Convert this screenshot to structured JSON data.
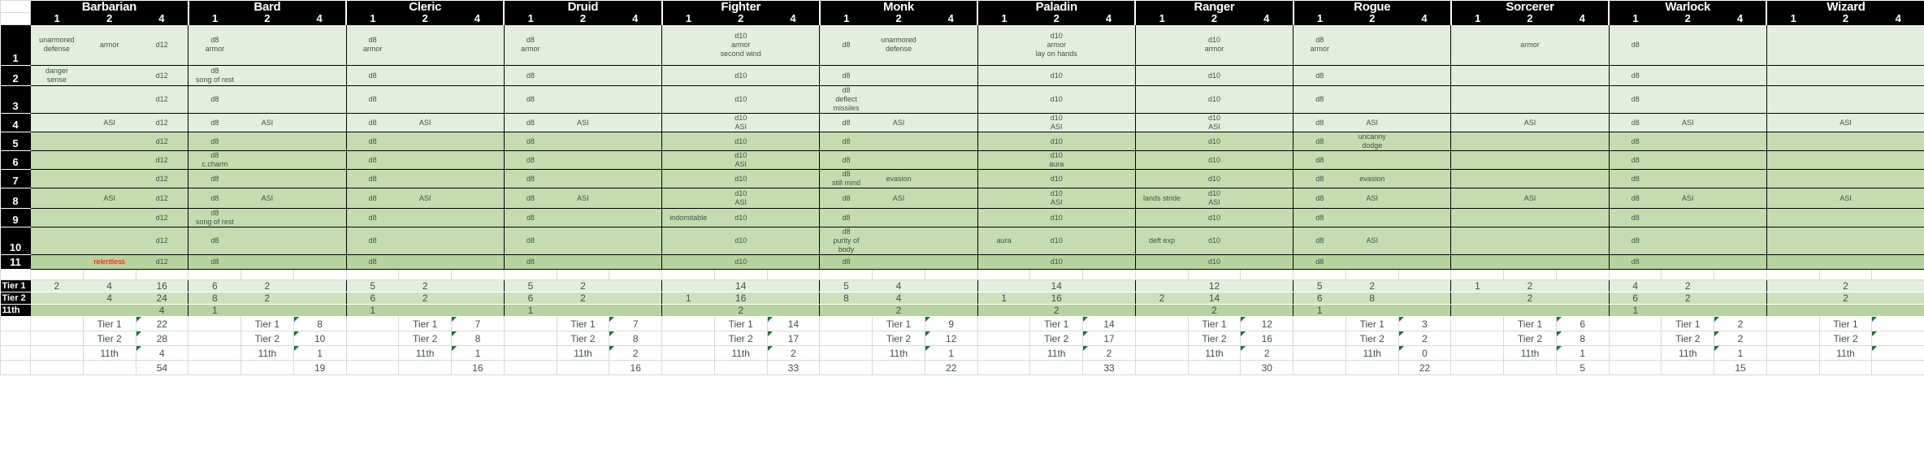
{
  "sheet": {
    "classes": [
      "Barbarian",
      "Bard",
      "Cleric",
      "Druid",
      "Fighter",
      "Monk",
      "Paladin",
      "Ranger",
      "Rogue",
      "Sorcerer",
      "Warlock",
      "Wizard"
    ],
    "subcolumns": [
      "1",
      "2",
      "4"
    ],
    "levels": [
      "1",
      "2",
      "3",
      "4",
      "5",
      "6",
      "7",
      "8",
      "9",
      "10",
      "11"
    ],
    "tier_labels": [
      "Tier 1",
      "Tier 2",
      "11th"
    ],
    "footer_labels": [
      "Tier 1",
      "Tier 2",
      "11th"
    ]
  },
  "grid": [
    {
      "level": "1",
      "tone": "a",
      "cells": [
        "unarmored\ndefense",
        "armor",
        "d12",
        "d8\narmor",
        "",
        "",
        "d8\narmor",
        "",
        "",
        "d8\narmor",
        "",
        "",
        "",
        "d10\narmor\nsecond wind",
        "",
        "d8",
        "unarmored\ndefense",
        "",
        "",
        "d10\narmor\nlay on hands",
        "",
        "",
        "d10\narmor",
        "",
        "d8\narmor",
        "",
        "",
        "",
        "armor",
        "",
        "d8",
        "",
        "",
        "",
        "",
        ""
      ]
    },
    {
      "level": "2",
      "tone": "a",
      "cells": [
        "danger\nsense",
        "",
        "d12",
        "d8\nsong of rest",
        "",
        "",
        "d8",
        "",
        "",
        "d8",
        "",
        "",
        "",
        "d10",
        "",
        "d8",
        "",
        "",
        "",
        "d10",
        "",
        "",
        "d10",
        "",
        "d8",
        "",
        "",
        "",
        "",
        "",
        "d8",
        "",
        "",
        "",
        "",
        ""
      ]
    },
    {
      "level": "3",
      "tone": "a",
      "cells": [
        "",
        "",
        "d12",
        "d8",
        "",
        "",
        "d8",
        "",
        "",
        "d8",
        "",
        "",
        "",
        "d10",
        "",
        "d8\ndeflect\nmissiles",
        "",
        "",
        "",
        "d10",
        "",
        "",
        "d10",
        "",
        "d8",
        "",
        "",
        "",
        "",
        "",
        "d8",
        "",
        "",
        "",
        "",
        ""
      ]
    },
    {
      "level": "4",
      "tone": "a",
      "cells": [
        "",
        "ASI",
        "d12",
        "d8",
        "ASI",
        "",
        "d8",
        "ASI",
        "",
        "d8",
        "ASI",
        "",
        "",
        "d10\nASI",
        "",
        "d8",
        "ASI",
        "",
        "",
        "d10\nASI",
        "",
        "",
        "d10\nASI",
        "",
        "d8",
        "ASI",
        "",
        "",
        "ASI",
        "",
        "d8",
        "ASI",
        "",
        "",
        "ASI",
        ""
      ]
    },
    {
      "level": "5",
      "tone": "b",
      "cells": [
        "",
        "",
        "d12",
        "d8",
        "",
        "",
        "d8",
        "",
        "",
        "d8",
        "",
        "",
        "",
        "d10",
        "",
        "d8",
        "",
        "",
        "",
        "d10",
        "",
        "",
        "d10",
        "",
        "d8",
        "uncanny\ndodge",
        "",
        "",
        "",
        "",
        "d8",
        "",
        "",
        "",
        "",
        ""
      ]
    },
    {
      "level": "6",
      "tone": "b",
      "cells": [
        "",
        "",
        "d12",
        "d8\nc.charm",
        "",
        "",
        "d8",
        "",
        "",
        "d8",
        "",
        "",
        "",
        "d10\nASI",
        "",
        "d8",
        "",
        "",
        "",
        "d10\naura",
        "",
        "",
        "d10",
        "",
        "d8",
        "",
        "",
        "",
        "",
        "",
        "d8",
        "",
        "",
        "",
        "",
        ""
      ]
    },
    {
      "level": "7",
      "tone": "b",
      "cells": [
        "",
        "",
        "d12",
        "d8",
        "",
        "",
        "d8",
        "",
        "",
        "d8",
        "",
        "",
        "",
        "d10",
        "",
        "d8\nstill mind",
        "evasion",
        "",
        "",
        "d10",
        "",
        "",
        "d10",
        "",
        "d8",
        "evasion",
        "",
        "",
        "",
        "",
        "d8",
        "",
        "",
        "",
        "",
        ""
      ]
    },
    {
      "level": "8",
      "tone": "b",
      "cells": [
        "",
        "ASI",
        "d12",
        "d8",
        "ASI",
        "",
        "d8",
        "ASI",
        "",
        "d8",
        "ASI",
        "",
        "",
        "d10\nASI",
        "",
        "d8",
        "ASI",
        "",
        "",
        "d10\nASI",
        "",
        "lands stride",
        "d10\nASI",
        "",
        "d8",
        "ASI",
        "",
        "",
        "ASI",
        "",
        "d8",
        "ASI",
        "",
        "",
        "ASI",
        ""
      ]
    },
    {
      "level": "9",
      "tone": "b",
      "cells": [
        "",
        "",
        "d12",
        "d8\nsong of rest",
        "",
        "",
        "d8",
        "",
        "",
        "d8",
        "",
        "",
        "indomitable",
        "d10",
        "",
        "d8",
        "",
        "",
        "",
        "d10",
        "",
        "",
        "d10",
        "",
        "d8",
        "",
        "",
        "",
        "",
        "",
        "d8",
        "",
        "",
        "",
        "",
        ""
      ]
    },
    {
      "level": "10",
      "tone": "b",
      "cells": [
        "",
        "",
        "d12",
        "d8",
        "",
        "",
        "d8",
        "",
        "",
        "d8",
        "",
        "",
        "",
        "d10",
        "",
        "d8\npurity of\nbody",
        "",
        "",
        "aura",
        "d10",
        "",
        "deft exp",
        "d10",
        "",
        "d8",
        "ASI",
        "",
        "",
        "",
        "",
        "d8",
        "",
        "",
        "",
        "",
        ""
      ]
    },
    {
      "level": "11",
      "tone": "c",
      "cells": [
        "",
        "relentless",
        "d12",
        "d8",
        "",
        "",
        "d8",
        "",
        "",
        "d8",
        "",
        "",
        "",
        "d10",
        "",
        "d8",
        "",
        "",
        "",
        "d10",
        "",
        "",
        "d10",
        "",
        "d8",
        "",
        "",
        "",
        "",
        "",
        "d8",
        "",
        "",
        "",
        "",
        ""
      ]
    }
  ],
  "tiers": [
    {
      "label": "Tier 1",
      "tone": "t1",
      "values": [
        "2",
        "4",
        "16",
        "6",
        "2",
        "",
        "5",
        "2",
        "",
        "5",
        "2",
        "",
        "",
        "14",
        "",
        "5",
        "4",
        "",
        "",
        "14",
        "",
        "",
        "12",
        "",
        "5",
        "2",
        "",
        "1",
        "2",
        "",
        "4",
        "2",
        "",
        "",
        "2",
        ""
      ]
    },
    {
      "label": "Tier 2",
      "tone": "t2",
      "values": [
        "",
        "4",
        "24",
        "8",
        "2",
        "",
        "6",
        "2",
        "",
        "6",
        "2",
        "",
        "1",
        "16",
        "",
        "8",
        "4",
        "",
        "1",
        "16",
        "",
        "2",
        "14",
        "",
        "6",
        "8",
        "",
        "",
        "2",
        "",
        "6",
        "2",
        "",
        "",
        "2",
        ""
      ]
    },
    {
      "label": "11th",
      "tone": "t3",
      "values": [
        "",
        "",
        "4",
        "1",
        "",
        "",
        "1",
        "",
        "",
        "1",
        "",
        "",
        "",
        "2",
        "",
        "",
        "2",
        "",
        "",
        "2",
        "",
        "",
        "2",
        "",
        "1",
        "",
        "",
        "",
        "",
        "",
        "1",
        "",
        "",
        "",
        "",
        ""
      ]
    }
  ],
  "footer": [
    {
      "kind": "tier1",
      "label": "Tier 1",
      "values": [
        "22",
        "8",
        "7",
        "7",
        "14",
        "9",
        "14",
        "12",
        "3",
        "6",
        "2",
        ""
      ]
    },
    {
      "kind": "tier2",
      "label": "Tier 2",
      "values": [
        "28",
        "10",
        "8",
        "8",
        "17",
        "12",
        "17",
        "16",
        "2",
        "8",
        "2",
        ""
      ]
    },
    {
      "kind": "11th",
      "label": "11th",
      "values": [
        "4",
        "1",
        "1",
        "2",
        "2",
        "1",
        "2",
        "2",
        "0",
        "1",
        "1",
        ""
      ]
    },
    {
      "kind": "total",
      "label": "",
      "values": [
        "54",
        "19",
        "16",
        "16",
        "33",
        "22",
        "33",
        "30",
        "22",
        "5",
        "15",
        ""
      ]
    }
  ],
  "footer_totals_comment": true,
  "colors": {
    "header_bg": "#000000",
    "header_fg": "#ffffff",
    "tone_light": "#e4eede",
    "tone_mid": "#c6dcb0",
    "tone_dark": "#b8d49e",
    "text": "#3f5340",
    "accent_red": "#ff0000",
    "comment_marker": "#127a2e"
  }
}
